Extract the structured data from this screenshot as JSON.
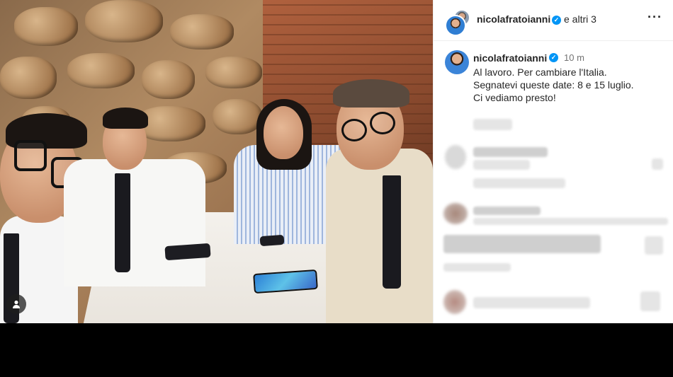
{
  "post": {
    "header": {
      "username": "nicolafratoianni",
      "others": "e altri 3",
      "more_icon": "more-options-icon"
    },
    "caption": {
      "username": "nicolafratoianni",
      "time": "10 m",
      "lines": [
        "Al lavoro. Per cambiare l'Italia.",
        "Segnatevi queste date: 8 e 15 luglio.",
        "Ci vediamo presto!"
      ]
    },
    "colors": {
      "verified": "#0095f6",
      "text": "#262626",
      "muted": "#737373"
    }
  }
}
